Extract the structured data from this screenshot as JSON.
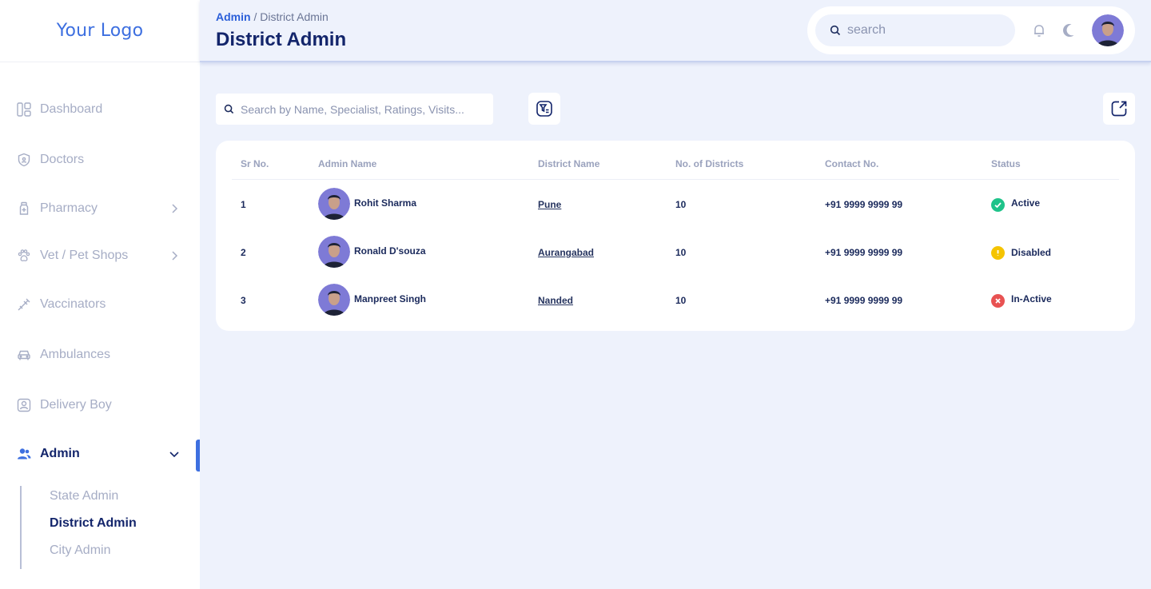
{
  "app": {
    "logo": "Your Logo"
  },
  "sidebar": {
    "items": [
      {
        "label": "Dashboard",
        "icon": "dashboard-icon"
      },
      {
        "label": "Doctors",
        "icon": "shield-icon"
      },
      {
        "label": "Pharmacy",
        "icon": "bottle-icon",
        "expandable": true
      },
      {
        "label": "Vet / Pet Shops",
        "icon": "paw-icon",
        "expandable": true
      },
      {
        "label": "Vaccinators",
        "icon": "syringe-icon"
      },
      {
        "label": "Ambulances",
        "icon": "car-icon"
      },
      {
        "label": "Delivery Boy",
        "icon": "user-badge-icon"
      },
      {
        "label": "Admin",
        "icon": "users-icon",
        "expandable": true,
        "active": true
      }
    ],
    "admin_sub": [
      {
        "label": "State Admin"
      },
      {
        "label": "District Admin",
        "active": true
      },
      {
        "label": "City Admin"
      }
    ]
  },
  "header": {
    "breadcrumb_root": "Admin",
    "breadcrumb_sep": "/",
    "breadcrumb_current": "District Admin",
    "title": "District Admin",
    "search_placeholder": "search"
  },
  "toolbar": {
    "search_placeholder": "Search by Name, Specialist, Ratings, Visits..."
  },
  "table": {
    "columns": [
      "Sr No.",
      "Admin Name",
      "District Name",
      "No. of Districts",
      "Contact No.",
      "Status"
    ],
    "rows": [
      {
        "sr": "1",
        "name": "Rohit Sharma",
        "district": "Pune",
        "count": "10",
        "contact": "+91 9999 9999 99",
        "status": "Active",
        "status_color": "#1fc38a"
      },
      {
        "sr": "2",
        "name": "Ronald D'souza",
        "district": "Aurangabad",
        "count": "10",
        "contact": "+91 9999 9999 99",
        "status": "Disabled",
        "status_color": "#f5c400"
      },
      {
        "sr": "3",
        "name": "Manpreet Singh",
        "district": "Nanded",
        "count": "10",
        "contact": "+91 9999 9999 99",
        "status": "In-Active",
        "status_color": "#e85252"
      }
    ]
  },
  "colors": {
    "accent": "#3d6fe0",
    "navy": "#13256b",
    "background": "#eef2fc"
  }
}
